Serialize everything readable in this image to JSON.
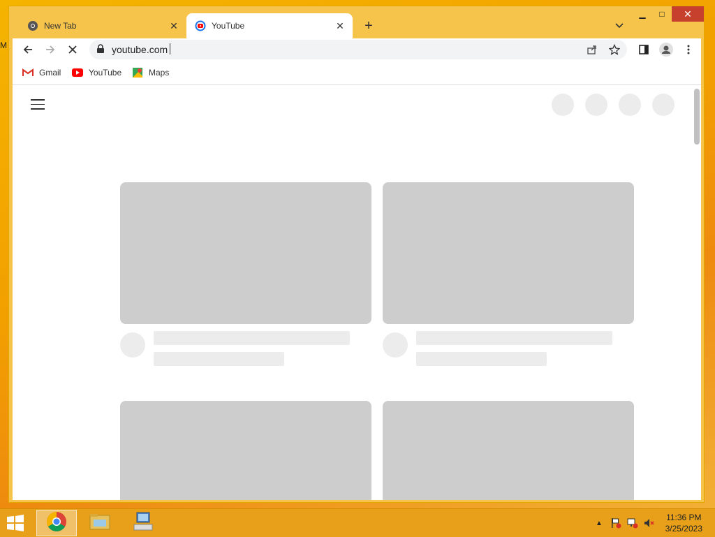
{
  "browser": {
    "tabs": [
      {
        "title": "New Tab",
        "favicon": "chrome-icon"
      },
      {
        "title": "YouTube",
        "favicon": "youtube-loading-icon"
      }
    ],
    "address": "youtube.com",
    "bookmarks": [
      {
        "label": "Gmail",
        "icon": "gmail-icon"
      },
      {
        "label": "YouTube",
        "icon": "youtube-icon"
      },
      {
        "label": "Maps",
        "icon": "maps-icon"
      }
    ]
  },
  "desktop": {
    "left_char": "M"
  },
  "taskbar": {
    "clock_time": "11:36 PM",
    "clock_date": "3/25/2023"
  },
  "colors": {
    "accent": "#c7402d",
    "placeholder": "#cdcdcd",
    "youtube_red": "#ff0000"
  }
}
